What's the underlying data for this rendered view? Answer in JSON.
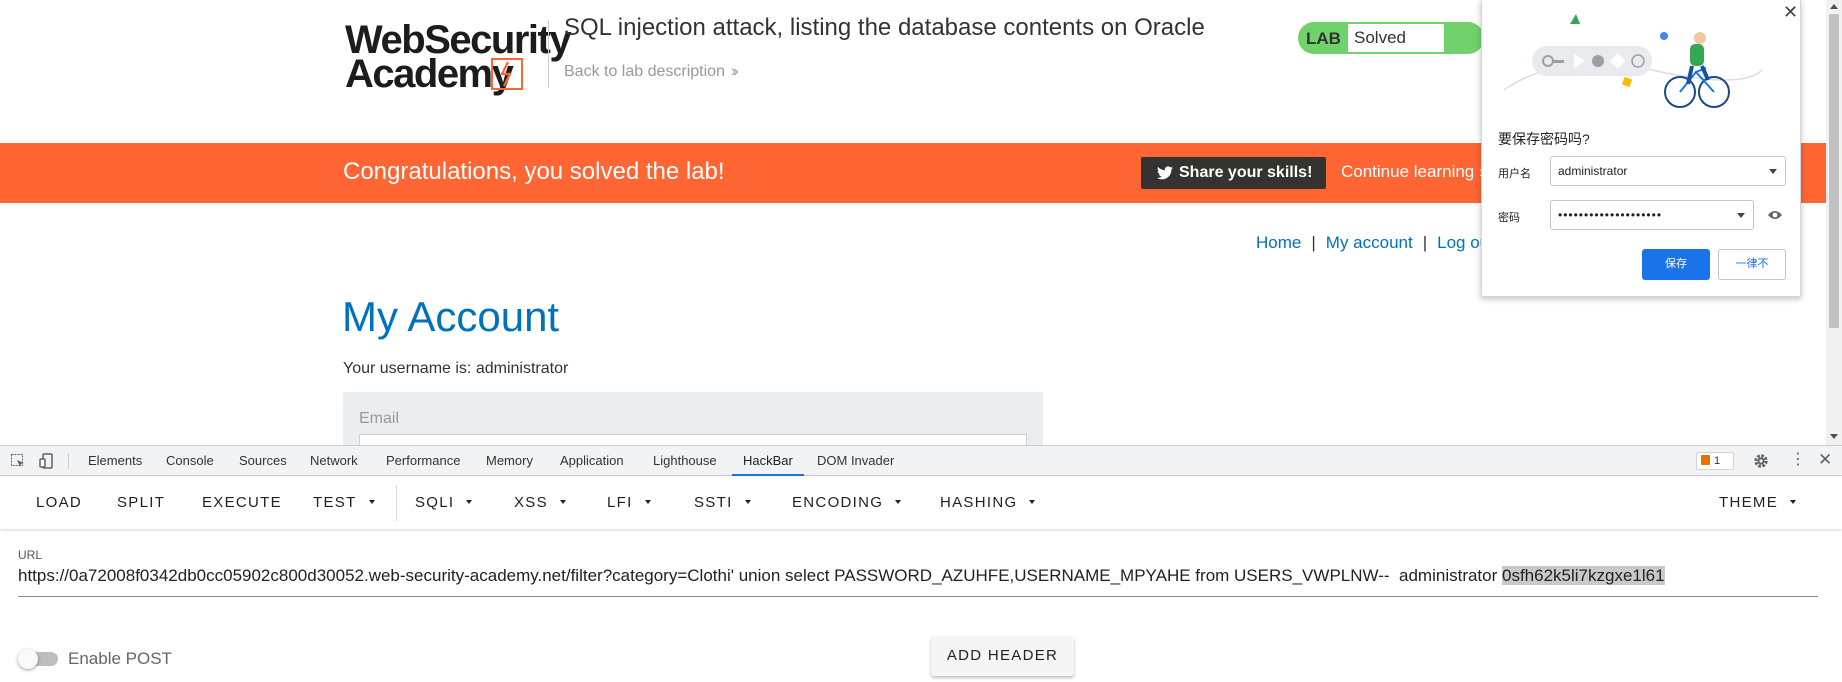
{
  "page": {
    "logo_line1": "WebSecurity",
    "logo_line2": "Academy",
    "lab_title": "SQL injection attack, listing the database contents on Oracle",
    "back_link": "Back to lab description",
    "lab_status_tag": "LAB",
    "lab_status_value": "Solved",
    "banner": {
      "message": "Congratulations, you solved the lab!",
      "share_button": "Share your skills!",
      "continue_link": "Continue learning"
    },
    "nav": {
      "home": "Home",
      "my_account": "My account",
      "log_out": "Log out",
      "separator": "|"
    },
    "heading": "My Account",
    "username_line": "Your username is: administrator",
    "email_label": "Email"
  },
  "password_prompt": {
    "question": "要保存密码吗?",
    "username_label": "用户名",
    "username_value": "administrator",
    "password_label": "密码",
    "password_value": "••••••••••••••••••••",
    "save_button": "保存",
    "never_button": "一律不"
  },
  "devtools": {
    "tabs": [
      "Elements",
      "Console",
      "Sources",
      "Network",
      "Performance",
      "Memory",
      "Application",
      "Lighthouse",
      "HackBar",
      "DOM Invader"
    ],
    "active_tab": "HackBar",
    "issues_count": "1"
  },
  "hackbar": {
    "buttons": {
      "load": "LOAD",
      "split": "SPLIT",
      "execute": "EXECUTE",
      "test": "TEST",
      "sqli": "SQLI",
      "xss": "XSS",
      "lfi": "LFI",
      "ssti": "SSTI",
      "encoding": "ENCODING",
      "hashing": "HASHING",
      "theme": "THEME"
    },
    "url_label": "URL",
    "url_text": "https://0a72008f0342db0cc05902c800d30052.web-security-academy.net/filter?category=Clothi' union select PASSWORD_AZUHFE,USERNAME_MPYAHE from USERS_VWPLNW--  administrator ",
    "url_selected": "0sfh62k5li7kzgxe1l61",
    "enable_post_label": "Enable POST",
    "add_header_button": "ADD HEADER"
  },
  "colors": {
    "brand_orange": "#ff6633",
    "link_blue": "#0071bc",
    "lab_green": "#70d16d",
    "chrome_blue": "#1a73e8"
  }
}
